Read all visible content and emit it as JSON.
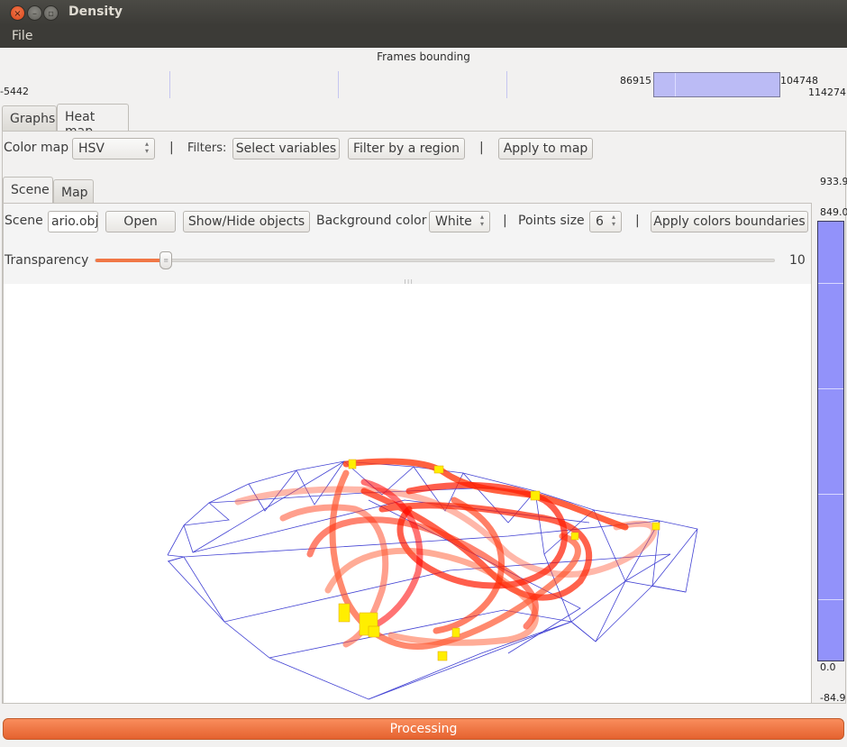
{
  "window": {
    "title": "Density",
    "controls": [
      "close-icon",
      "minimize-icon",
      "maximize-icon"
    ]
  },
  "menubar": {
    "items": [
      {
        "label": "File"
      }
    ]
  },
  "frames_bounding": {
    "title": "Frames bounding",
    "min_label": "-5442",
    "max_label": "114274",
    "selection_start": "86915",
    "selection_end": "104748"
  },
  "top_tabs": [
    {
      "label": "Graphs",
      "active": false
    },
    {
      "label": "Heat map",
      "active": true
    }
  ],
  "heatmap_toolbar": {
    "color_map_label": "Color map",
    "color_map_value": "HSV",
    "separator": "|",
    "filters_label": "Filters:",
    "select_variables": "Select variables",
    "filter_by_region": "Filter by a region",
    "apply_to_map": "Apply to map"
  },
  "inner_tabs": [
    {
      "label": "Scene",
      "active": true
    },
    {
      "label": "Map",
      "active": false
    }
  ],
  "scene_toolbar": {
    "scene_label": "Scene",
    "scene_file": "ario.obj",
    "open": "Open",
    "show_hide": "Show/Hide objects",
    "bg_color_label": "Background color",
    "bg_color_value": "White",
    "points_size_label": "Points size",
    "points_size_value": "6",
    "apply_colors": "Apply colors boundaries",
    "separator": "|"
  },
  "transparency": {
    "label": "Transparency",
    "value": "10",
    "fraction": 0.105
  },
  "legend": {
    "labels": [
      "933.9",
      "849.0",
      "0.0",
      "-84.9"
    ],
    "color": "#9292fa"
  },
  "progress": {
    "label": "Processing",
    "color": "#ef7443"
  }
}
